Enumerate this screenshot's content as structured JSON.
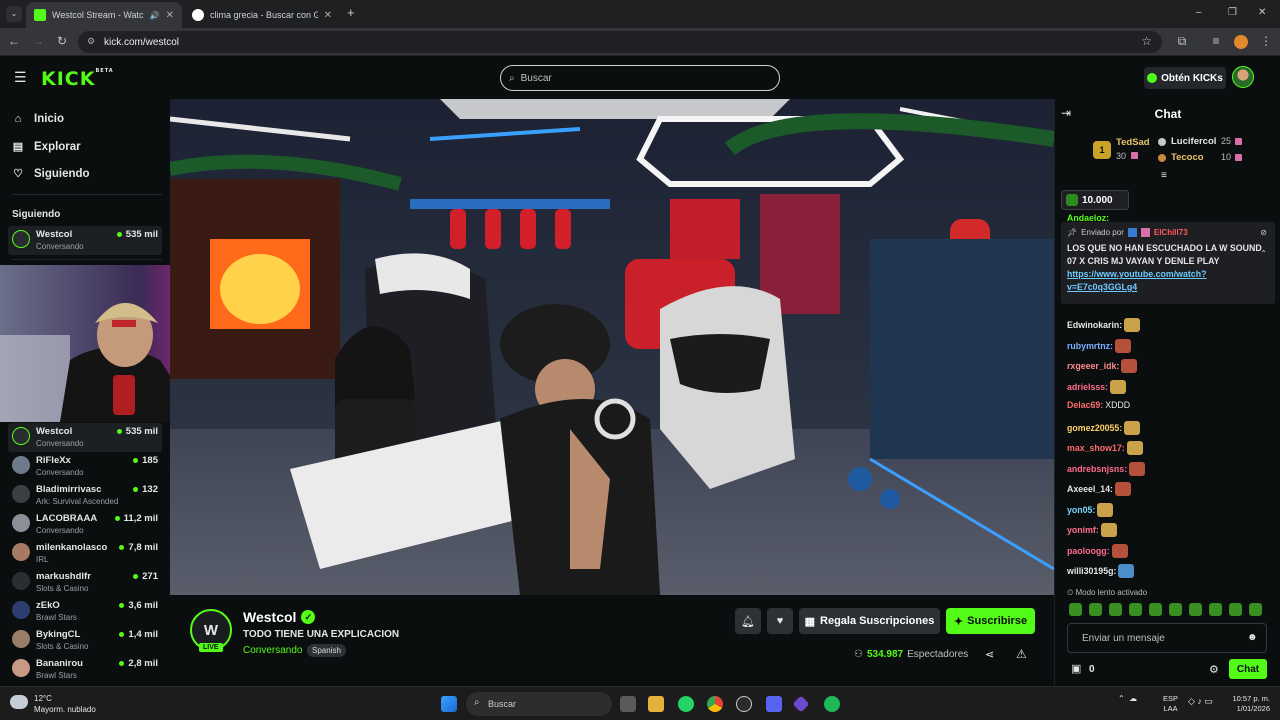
{
  "browser": {
    "tabs": [
      {
        "title": "Westcol Stream - Watch Live",
        "active": true
      },
      {
        "title": "clima grecia - Buscar con Google",
        "active": false
      }
    ],
    "new_tab": "+",
    "url": "kick.com/westcol",
    "window_controls": [
      "–",
      "❐",
      "✕"
    ]
  },
  "header": {
    "logo": "KICK",
    "logo_badge": "BETA",
    "search_placeholder": "Buscar",
    "get_kicks": "Obtén KICKs"
  },
  "sidebar": {
    "nav": [
      {
        "label": "Inicio",
        "icon": "home-icon"
      },
      {
        "label": "Explorar",
        "icon": "browse-icon"
      },
      {
        "label": "Siguiendo",
        "icon": "heart-icon"
      }
    ],
    "following_title": "Siguiendo",
    "top_channel": {
      "name": "Westcol",
      "category": "Conversando",
      "viewers": "535 mil"
    },
    "channels": [
      {
        "name": "Westcol",
        "category": "Conversando",
        "viewers": "535 mil"
      },
      {
        "name": "RiFleXx",
        "category": "Conversando",
        "viewers": "185"
      },
      {
        "name": "Bladimirrivasc",
        "category": "Ark: Survival Ascended",
        "viewers": "132"
      },
      {
        "name": "LACOBRAAA",
        "category": "Conversando",
        "viewers": "11,2 mil"
      },
      {
        "name": "milenkanolasco",
        "category": "IRL",
        "viewers": "7,8 mil"
      },
      {
        "name": "markushdlfr",
        "category": "Slots & Casino",
        "viewers": "271"
      },
      {
        "name": "zEkO",
        "category": "Brawl Stars",
        "viewers": "3,6 mil"
      },
      {
        "name": "BykingCL",
        "category": "Slots & Casino",
        "viewers": "1,4 mil"
      },
      {
        "name": "Bananirou",
        "category": "Brawl Stars",
        "viewers": "2,8 mil"
      }
    ]
  },
  "stream": {
    "initials": "W",
    "live_label": "LIVE",
    "streamer": "Westcol",
    "title": "TODO TIENE UNA EXPLICACION",
    "category": "Conversando",
    "language": "Spanish",
    "gift_label": "Regala Suscripciones",
    "subscribe_label": "Suscribirse",
    "viewers_count": "534.987",
    "viewers_label": "Espectadores"
  },
  "chat": {
    "title": "Chat",
    "leaderboard": [
      {
        "name": "TedSad",
        "count": "30",
        "color": "#e9c46a"
      },
      {
        "name": "Lucifercol",
        "count": "25",
        "color": "#e6e6e6"
      },
      {
        "name": "Tecoco",
        "count": "10",
        "color": "#e9c46a"
      }
    ],
    "leaderboard_rank": "1",
    "kicks_amount": "10.000",
    "partial_user": "Andaeloz:",
    "pinned": {
      "sent_by_label": "Enviado por",
      "sent_by_user": "ElChill73",
      "text": "LOS QUE NO HAN ESCUCHADO LA W SOUND 07 X CRIS MJ VAYAN Y DENLE PLAY",
      "link": "https://www.youtube.com/watch?v=E7c0q3GGLg4"
    },
    "messages": [
      {
        "user": "Edwinokarin:",
        "color": "#e6e6e6",
        "text": "",
        "emote": "gold"
      },
      {
        "user": "rubymrtnz:",
        "color": "#7ab0ff",
        "text": "",
        "emote": "red"
      },
      {
        "user": "rxgeeer_idk:",
        "color": "#ff8a8a",
        "text": "",
        "emote": "red"
      },
      {
        "user": "adrielsss:",
        "color": "#ff6b8b",
        "text": "",
        "emote": "gold"
      },
      {
        "user": "Delac69:",
        "color": "#ff6b6b",
        "text": "XDDD",
        "emote": ""
      },
      {
        "user": "gomez20055:",
        "color": "#ffd166",
        "text": "",
        "emote": "gold"
      },
      {
        "user": "max_show17:",
        "color": "#ff6b6b",
        "text": "",
        "emote": "gold"
      },
      {
        "user": "andrebsnjsns:",
        "color": "#ff6b8b",
        "text": "",
        "emote": "red"
      },
      {
        "user": "Axeeel_14:",
        "color": "#e6e6e6",
        "text": "",
        "emote": "red"
      },
      {
        "user": "yon05:",
        "color": "#7ad7ff",
        "text": "",
        "emote": "gold"
      },
      {
        "user": "yonimf:",
        "color": "#ff6b8b",
        "text": "",
        "emote": "gold"
      },
      {
        "user": "paoloogg:",
        "color": "#ff6b8b",
        "text": "",
        "emote": "red"
      },
      {
        "user": "willi30195g:",
        "color": "#e6e6e6",
        "text": "",
        "emote": "blue"
      }
    ],
    "slow_mode": "Modo lento activado",
    "input_placeholder": "Enviar un mensaje",
    "count": "0",
    "send_label": "Chat"
  },
  "taskbar": {
    "weather_temp": "12°C",
    "weather_desc": "Mayorm. nublado",
    "search": "Buscar",
    "lang_top": "ESP",
    "lang_bottom": "LAA",
    "time": "10:57 p. m.",
    "date": "1/01/2026"
  },
  "colors": {
    "accent": "#53fc18",
    "bg": "#0b0e0f",
    "panel": "#2d3035"
  }
}
